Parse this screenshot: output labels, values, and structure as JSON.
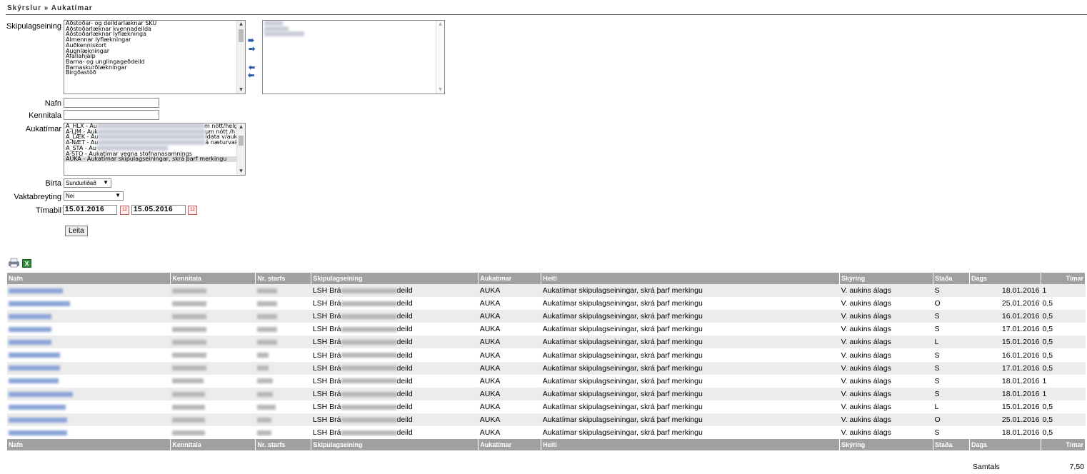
{
  "breadcrumb": "Skýrslur » Aukatímar",
  "form": {
    "labels": {
      "skipulag": "Skipulagseining",
      "nafn": "Nafn",
      "kennitala": "Kennitala",
      "aukatimar": "Aukatímar",
      "birta": "Birta",
      "vaktabreyting": "Vaktabreyting",
      "timabil": "Tímabil"
    },
    "skipulag_options": [
      "Aðstoðar- og deildarlæknar SKU",
      "Aðstoðarlæknar kvennadeilda",
      "Aðstoðarlæknar lyflækninga",
      "Almennar lyflækningar",
      "Auðkenniskort",
      "Augnlækningar",
      "Áfallahjálp",
      "Barna- og unglingageðdeild",
      "Barnaskurðlækningar",
      "Birgðastöð"
    ],
    "aukatimar_options": [
      {
        "prefix": "A_HLX - Au",
        "suffix": "m nótt/helgi"
      },
      {
        "prefix": "A-LJM - Auk",
        "suffix": "um nótt /h"
      },
      {
        "prefix": "A_LÆK - Au",
        "suffix": "ídata v/auk"
      },
      {
        "prefix": "A-NÆT - Au",
        "suffix": "á næturvak"
      },
      {
        "prefix": "A_STA - Au",
        "suffix": ""
      },
      {
        "prefix": "A-STO - Aukatímar vegna stofnanasamnings",
        "suffix": ""
      },
      {
        "prefix": "AUKA - Aukatímar skipulagseiningar, skrá þarf merkingu",
        "suffix": ""
      }
    ],
    "birta_value": "Sundurliðað",
    "vaktabreyting_value": "Nei",
    "date_from": "15.01.2016",
    "date_to": "15.05.2016",
    "search_button": "Leita"
  },
  "table": {
    "headers": [
      "Nafn",
      "Kennitala",
      "Nr. starfs",
      "Skipulagseining",
      "Aukatímar",
      "Heiti",
      "Skýring",
      "Staða",
      "Dags",
      "Tímar"
    ],
    "rows": [
      {
        "nafn_w": 76,
        "kt_w": 48,
        "nr_w": 28,
        "skip_a": "LSH Brá",
        "skip_b": "deild",
        "auka": "AUKA",
        "heiti": "Aukatímar skipulagseiningar, skrá þarf merkingu",
        "skyring": "V. aukins álags",
        "stada": "S",
        "dags": "18.01.2016",
        "timar": "1"
      },
      {
        "nafn_w": 86,
        "kt_w": 48,
        "nr_w": 28,
        "skip_a": "LSH Brá",
        "skip_b": "deild",
        "auka": "AUKA",
        "heiti": "Aukatímar skipulagseiningar, skrá þarf merkingu",
        "skyring": "V. aukins álags",
        "stada": "O",
        "dags": "25.01.2016",
        "timar": "0,5"
      },
      {
        "nafn_w": 60,
        "kt_w": 48,
        "nr_w": 28,
        "skip_a": "LSH Brá",
        "skip_b": "deild",
        "auka": "AUKA",
        "heiti": "Aukatímar skipulagseiningar, skrá þarf merkingu",
        "skyring": "V. aukins álags",
        "stada": "S",
        "dags": "16.01.2016",
        "timar": "0,5"
      },
      {
        "nafn_w": 60,
        "kt_w": 48,
        "nr_w": 28,
        "skip_a": "LSH Brá",
        "skip_b": "deild",
        "auka": "AUKA",
        "heiti": "Aukatímar skipulagseiningar, skrá þarf merkingu",
        "skyring": "V. aukins álags",
        "stada": "S",
        "dags": "17.01.2016",
        "timar": "0,5"
      },
      {
        "nafn_w": 60,
        "kt_w": 48,
        "nr_w": 28,
        "skip_a": "LSH Brá",
        "skip_b": "deild",
        "auka": "AUKA",
        "heiti": "Aukatímar skipulagseiningar, skrá þarf merkingu",
        "skyring": "V. aukins álags",
        "stada": "L",
        "dags": "15.01.2016",
        "timar": "0,5"
      },
      {
        "nafn_w": 72,
        "kt_w": 48,
        "nr_w": 16,
        "skip_a": "LSH Brá",
        "skip_b": "deild",
        "auka": "AUKA",
        "heiti": "Aukatímar skipulagseiningar, skrá þarf merkingu",
        "skyring": "V. aukins álags",
        "stada": "S",
        "dags": "16.01.2016",
        "timar": "0,5"
      },
      {
        "nafn_w": 72,
        "kt_w": 48,
        "nr_w": 16,
        "skip_a": "LSH Brá",
        "skip_b": "deild",
        "auka": "AUKA",
        "heiti": "Aukatímar skipulagseiningar, skrá þarf merkingu",
        "skyring": "V. aukins álags",
        "stada": "S",
        "dags": "17.01.2016",
        "timar": "0,5"
      },
      {
        "nafn_w": 70,
        "kt_w": 44,
        "nr_w": 22,
        "skip_a": "LSH Brá",
        "skip_b": "deild",
        "auka": "AUKA",
        "heiti": "Aukatímar skipulagseiningar, skrá þarf merkingu",
        "skyring": "V. aukins álags",
        "stada": "S",
        "dags": "18.01.2016",
        "timar": "1"
      },
      {
        "nafn_w": 90,
        "kt_w": 46,
        "nr_w": 22,
        "skip_a": "LSH Brá",
        "skip_b": "deild",
        "auka": "AUKA",
        "heiti": "Aukatímar skipulagseiningar, skrá þarf merkingu",
        "skyring": "V. aukins álags",
        "stada": "S",
        "dags": "18.01.2016",
        "timar": "1"
      },
      {
        "nafn_w": 80,
        "kt_w": 46,
        "nr_w": 26,
        "skip_a": "LSH Brá",
        "skip_b": "deild",
        "auka": "AUKA",
        "heiti": "Aukatímar skipulagseiningar, skrá þarf merkingu",
        "skyring": "V. aukins álags",
        "stada": "L",
        "dags": "15.01.2016",
        "timar": "0,5"
      },
      {
        "nafn_w": 82,
        "kt_w": 46,
        "nr_w": 20,
        "skip_a": "LSH Brá",
        "skip_b": "deild",
        "auka": "AUKA",
        "heiti": "Aukatímar skipulagseiningar, skrá þarf merkingu",
        "skyring": "V. aukins álags",
        "stada": "O",
        "dags": "25.01.2016",
        "timar": "0,5"
      },
      {
        "nafn_w": 82,
        "kt_w": 46,
        "nr_w": 20,
        "skip_a": "LSH Brá",
        "skip_b": "deild",
        "auka": "AUKA",
        "heiti": "Aukatímar skipulagseiningar, skrá þarf merkingu",
        "skyring": "V. aukins álags",
        "stada": "S",
        "dags": "18.01.2016",
        "timar": "0,5"
      }
    ],
    "total_label": "Samtals",
    "total_value": "7,50"
  }
}
